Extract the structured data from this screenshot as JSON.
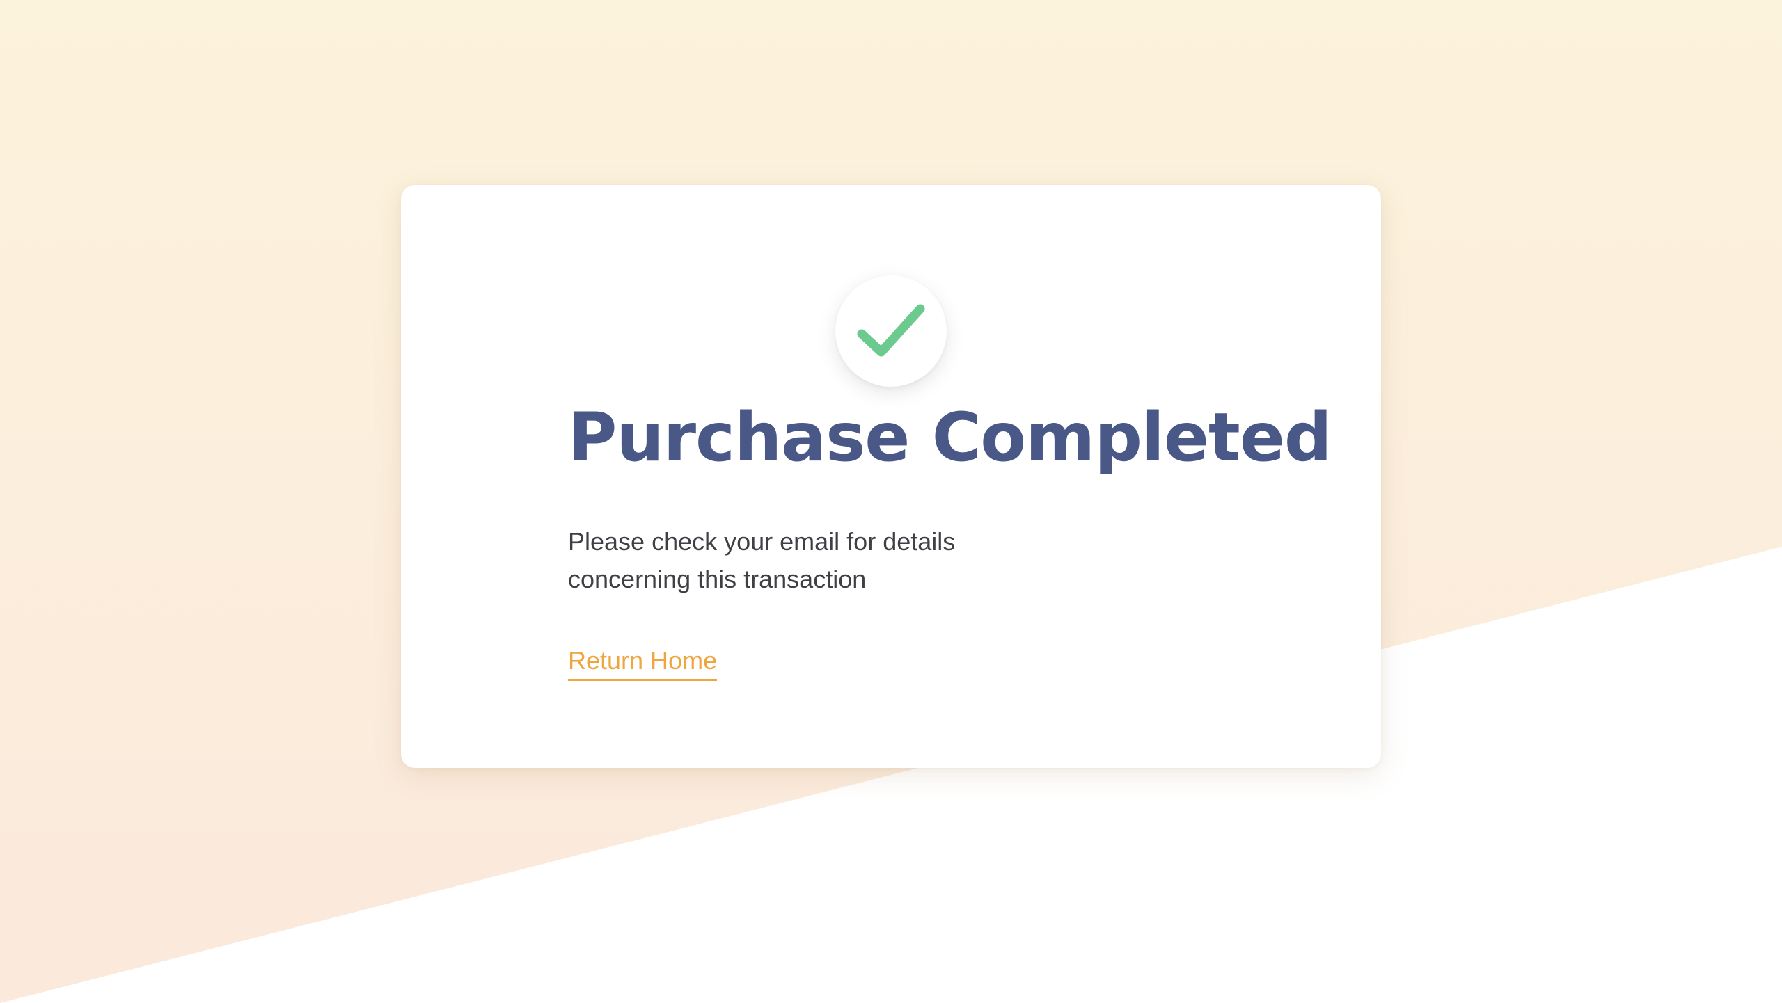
{
  "colors": {
    "background_gradient_top": "#fcf3dc",
    "background_gradient_bottom": "#fbe9dc",
    "lower_background": "#ffffff",
    "card": "#ffffff",
    "check": "#6cca8f",
    "title": "#4a5888",
    "body_text": "#3f3f46",
    "link": "#f0a640"
  },
  "card": {
    "icon": "checkmark-icon",
    "title": "Purchase Completed",
    "message": "Please check your email for details concerning this transaction",
    "link_label": "Return Home"
  }
}
